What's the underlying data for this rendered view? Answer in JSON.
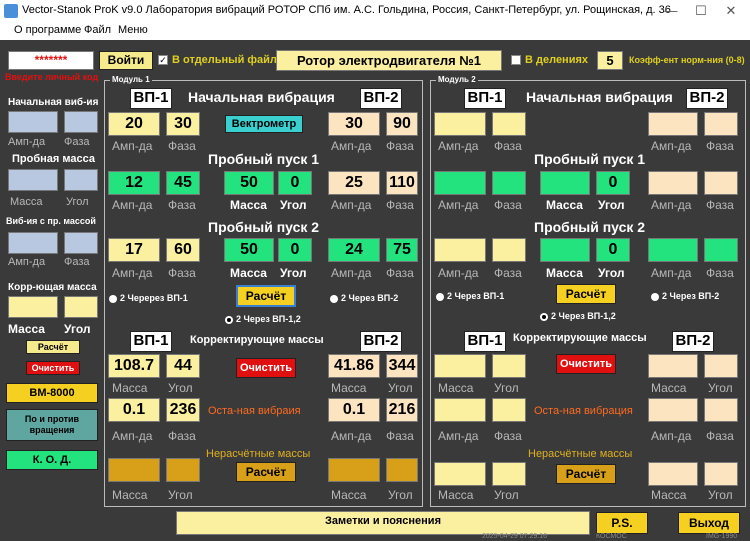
{
  "title": "Vector-Stanok ProK v9.0  Лаборатория вибраций РОТОР СПб им. А.С. Гольдина, Россия,  Санкт-Петербург, ул. Рощинская, д. 36",
  "menu": [
    "О программе",
    "Файл",
    "Меню"
  ],
  "top": {
    "password": "*******",
    "login": "Войти",
    "separate_file": "В отдельный файл",
    "rotor": "Ротор электродвигателя №1",
    "divisions": "В делениях",
    "coef": "5",
    "coef_label": "Коэфф-ент норм-ния (0-8)",
    "code_hint": "Введите личный код"
  },
  "side": {
    "initial": "Начальная виб-ия",
    "amp": "Амп-да",
    "phase": "Фаза",
    "trial_mass": "Пробная масса",
    "mass": "Масса",
    "angle": "Угол",
    "vib_trial": "Виб-ия с пр. массой",
    "corr_mass": "Корр-ющая масса",
    "calc": "Расчёт",
    "clear": "Очистить",
    "bm": "BM-8000",
    "rot": "По и против вращения",
    "kod": "К. О. Д."
  },
  "m1": {
    "legend": "Модуль 1",
    "vp1": "ВП-1",
    "vp2": "ВП-2",
    "initial": "Начальная вибрация",
    "vect": "Вектрометр",
    "iv": [
      "20",
      "30",
      "30",
      "90"
    ],
    "trial1": "Пробный пуск 1",
    "t1": [
      "12",
      "45",
      "50",
      "0",
      "25",
      "110"
    ],
    "trial2": "Пробный пуск 2",
    "t2": [
      "17",
      "60",
      "50",
      "0",
      "24",
      "75"
    ],
    "amp": "Амп-да",
    "phase": "Фаза",
    "mass": "Масса",
    "angle": "Угол",
    "r1": "2 Черерез ВП-1",
    "r2": "2 Через ВП-2",
    "r3": "2 Через ВП-1,2",
    "calc": "Расчёт",
    "corr": "Корректирующие массы",
    "cm": [
      "108.7",
      "44",
      "41.86",
      "344"
    ],
    "clear": "Очистить",
    "resid": "Оста-ная вибраия",
    "rv": [
      "0.1",
      "236",
      "0.1",
      "216"
    ],
    "unc": "Нерасчётные массы",
    "calc2": "Расчёт"
  },
  "m2": {
    "legend": "Модуль 2",
    "vp1": "ВП-1",
    "vp2": "ВП-2",
    "initial": "Начальная вибрация",
    "trial1": "Пробный пуск 1",
    "t1zero": "0",
    "trial2": "Пробный пуск 2",
    "t2zero": "0",
    "amp": "Амп-да",
    "phase": "Фаза",
    "mass": "Масса",
    "angle": "Угол",
    "r1": "2 Через ВП-1",
    "r2": "2 Через ВП-2",
    "r3": "2 Через ВП-1,2",
    "calc": "Расчёт",
    "corr": "Корректирующие массы",
    "clear": "Очистить",
    "resid": "Оста-ная вибрация",
    "unc": "Нерасчётные массы",
    "calc2": "Расчёт"
  },
  "bottom": {
    "notes": "Заметки и пояснения",
    "ps": "P.S.",
    "exit": "Выход",
    "s1": "2025-04-29 07:29:16",
    "s2": "КОСМОС",
    "s3": "IMG-1990"
  },
  "colors": {
    "bg": "#3a3a3a",
    "yellow": "#fbefa0",
    "green": "#22e37e",
    "blue": "#b8c8e0",
    "gold": "#d8a018",
    "red": "#e01010",
    "orange": "#ff6a20"
  }
}
